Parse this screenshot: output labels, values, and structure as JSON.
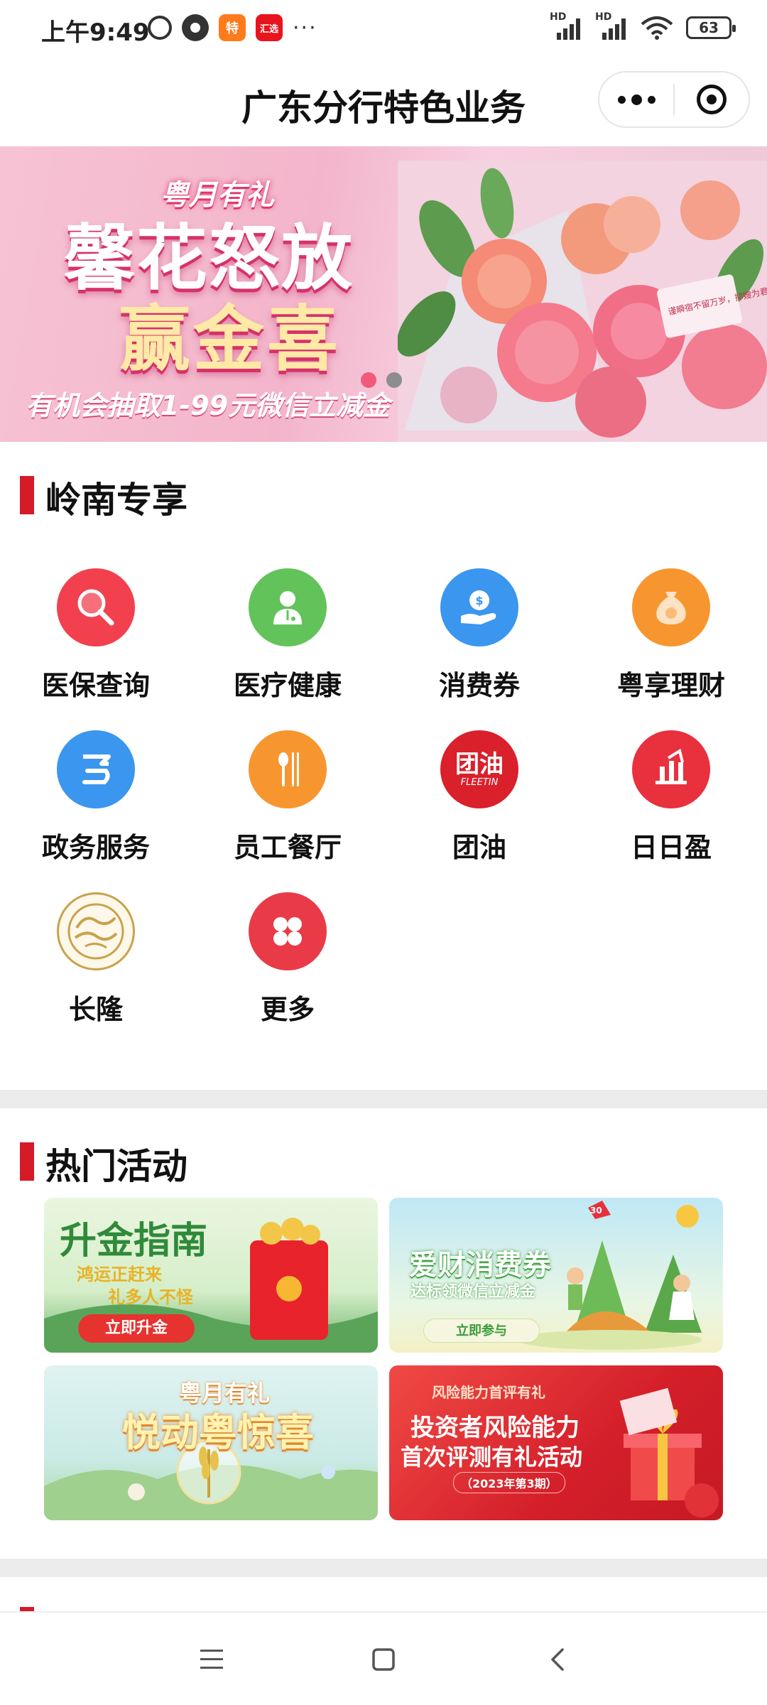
{
  "status_bar": {
    "time": "上午9:49",
    "app_icons": [
      "alarm-icon",
      "app-dot-icon",
      "tebao-app-icon",
      "huixuan-app-icon"
    ],
    "app_icon_labels": {
      "tebao": "特",
      "huixuan": "汇选"
    },
    "more": "···",
    "network_hd1": "HD",
    "network_hd2": "HD",
    "battery": "63"
  },
  "header": {
    "title": "广东分行特色业务"
  },
  "banner": {
    "tag": "粤月有礼",
    "line1": "馨花怒放",
    "line2": "赢金喜",
    "subtitle": "有机会抽取1-99元微信立减金",
    "card_text": "谨瞬宿不留万岁，抑嫂为君的超人！",
    "dots": 2,
    "active_dot": 0
  },
  "lingnan": {
    "title": "岭南专享",
    "items": [
      {
        "label": "医保查询",
        "icon": "search-icon",
        "color": "#f2404f"
      },
      {
        "label": "医疗健康",
        "icon": "doctor-icon",
        "color": "#62c35a"
      },
      {
        "label": "消费券",
        "icon": "coin-hand-icon",
        "color": "#3a96ee"
      },
      {
        "label": "粤享理财",
        "icon": "money-bag-icon",
        "color": "#f7962f"
      },
      {
        "label": "政务服务",
        "icon": "gov-service-icon",
        "color": "#3a96ee"
      },
      {
        "label": "员工餐厅",
        "icon": "cutlery-icon",
        "color": "#f7962f"
      },
      {
        "label": "团油",
        "icon": "tuanyou-logo-icon",
        "color": "#d9202b",
        "logo_text": "团油",
        "logo_sub": "FLEETIN"
      },
      {
        "label": "日日盈",
        "icon": "chart-up-icon",
        "color": "#e9303d"
      },
      {
        "label": "长隆",
        "icon": "chimelong-logo-icon",
        "color": "#c9a24a"
      },
      {
        "label": "更多",
        "icon": "more-grid-icon",
        "color": "#e93b47"
      }
    ]
  },
  "activities": {
    "title": "热门活动",
    "cards": [
      {
        "title": "升金指南",
        "sub1": "鸿运正赶来",
        "sub2": "礼多人不怪",
        "button": "立即升金"
      },
      {
        "title": "爱财消费券",
        "sub1": "达标领微信立减金",
        "button": "立即参与",
        "kite_text": "30"
      },
      {
        "tag": "粤月有礼",
        "title": "悦动粤惊喜"
      },
      {
        "tag": "风险能力首评有礼",
        "line1": "投资者风险能力",
        "line2": "首次评测有礼活动",
        "note": "（2023年第3期）"
      }
    ]
  },
  "nav": {
    "buttons": [
      "menu-icon",
      "home-icon",
      "back-icon"
    ]
  },
  "colors": {
    "accent_red": "#d41b27",
    "divider": "#ececec"
  }
}
